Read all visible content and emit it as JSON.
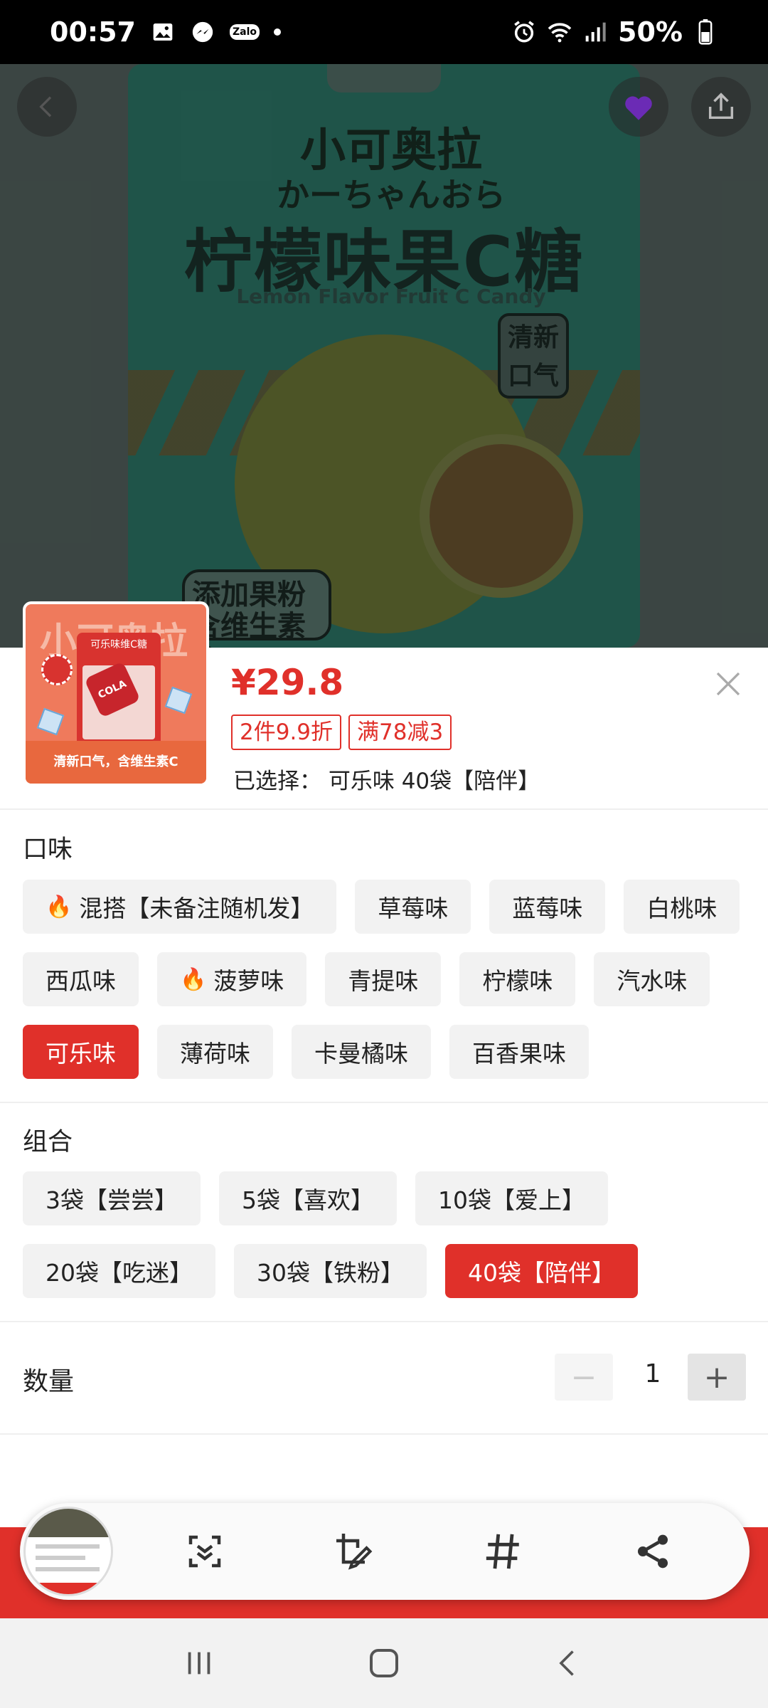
{
  "status_bar": {
    "time": "00:57",
    "zalo": "Zalo",
    "battery": "50%"
  },
  "hero": {
    "brand": "小可奥拉",
    "brand_sub": "かーちゃんおら",
    "title": "柠檬味果C糖",
    "title_en": "Lemon Flavor Fruit C Candy",
    "tag_fresh": "清新口气",
    "tag_vitc": "添加果粉含维生素C"
  },
  "thumb": {
    "title": "小可奥拉",
    "bag_text": "可乐味维C糖",
    "can_text": "COLA",
    "footer": "清新口气，含维生素C"
  },
  "product": {
    "price": "¥29.8",
    "coupons": [
      "2件9.9折",
      "满78减3"
    ],
    "selected": "已选择：  可乐味 40袋【陪伴】"
  },
  "flavor": {
    "title": "口味",
    "options": [
      {
        "label": "混搭【未备注随机发】",
        "hot": true,
        "active": false
      },
      {
        "label": "草莓味",
        "hot": false,
        "active": false
      },
      {
        "label": "蓝莓味",
        "hot": false,
        "active": false
      },
      {
        "label": "白桃味",
        "hot": false,
        "active": false
      },
      {
        "label": "西瓜味",
        "hot": false,
        "active": false
      },
      {
        "label": "菠萝味",
        "hot": true,
        "active": false
      },
      {
        "label": "青提味",
        "hot": false,
        "active": false
      },
      {
        "label": "柠檬味",
        "hot": false,
        "active": false
      },
      {
        "label": "汽水味",
        "hot": false,
        "active": false
      },
      {
        "label": "可乐味",
        "hot": false,
        "active": true
      },
      {
        "label": "薄荷味",
        "hot": false,
        "active": false
      },
      {
        "label": "卡曼橘味",
        "hot": false,
        "active": false
      },
      {
        "label": "百香果味",
        "hot": false,
        "active": false
      }
    ]
  },
  "combo": {
    "title": "组合",
    "options": [
      {
        "label": "3袋【尝尝】",
        "active": false
      },
      {
        "label": "5袋【喜欢】",
        "active": false
      },
      {
        "label": "10袋【爱上】",
        "active": false
      },
      {
        "label": "20袋【吃迷】",
        "active": false
      },
      {
        "label": "30袋【铁粉】",
        "active": false
      },
      {
        "label": "40袋【陪伴】",
        "active": true
      }
    ]
  },
  "quantity": {
    "label": "数量",
    "value": "1",
    "minus": "−",
    "plus": "+"
  },
  "colors": {
    "accent": "#e0302a",
    "chip_bg": "#f2f2f2"
  },
  "icons": {
    "back": "chevron-left-icon",
    "favorite": "heart-icon",
    "share": "share-icon",
    "close": "close-icon",
    "scan": "scroll-capture-icon",
    "edit": "crop-edit-icon",
    "tag": "hashtag-icon",
    "toolbar_share": "share-icon",
    "nav_recent": "recent-apps-icon",
    "nav_home": "home-icon",
    "nav_back": "back-icon"
  }
}
